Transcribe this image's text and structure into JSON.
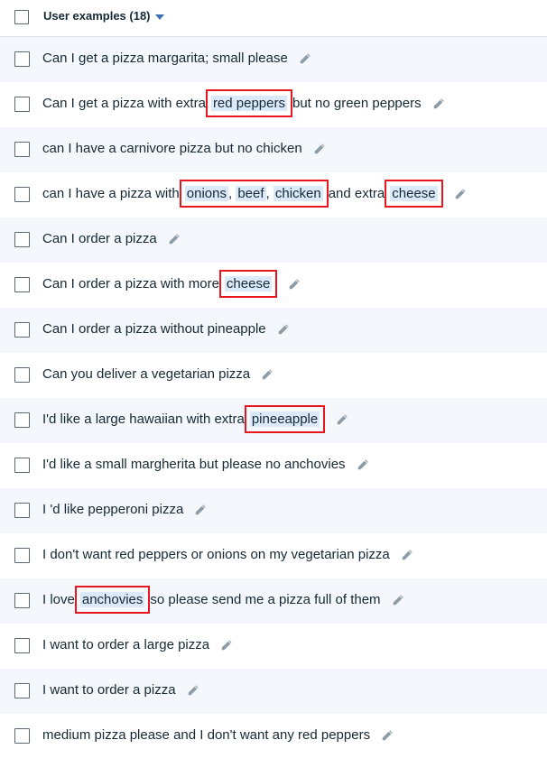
{
  "header": {
    "title": "User examples (18)"
  },
  "rows": [
    {
      "segments": [
        {
          "t": "Can I get a pizza margarita; small please"
        }
      ]
    },
    {
      "segments": [
        {
          "t": "Can I get a pizza with extra"
        },
        {
          "t": "red peppers",
          "ent": true,
          "box": true
        },
        {
          "t": "but no green peppers"
        }
      ]
    },
    {
      "segments": [
        {
          "t": "can I have a carnivore pizza but no chicken"
        }
      ]
    },
    {
      "segments": [
        {
          "t": "can I have a pizza with"
        },
        {
          "t": "onions",
          "ent": true,
          "box": "start"
        },
        {
          "t": ", ",
          "inbox": true
        },
        {
          "t": "beef",
          "ent": true,
          "inbox": true
        },
        {
          "t": ", ",
          "inbox": true
        },
        {
          "t": "chicken",
          "ent": true,
          "box": "end"
        },
        {
          "t": "and extra"
        },
        {
          "t": "cheese",
          "ent": true,
          "box": true
        }
      ]
    },
    {
      "segments": [
        {
          "t": "Can I order a pizza"
        }
      ]
    },
    {
      "segments": [
        {
          "t": "Can I order a pizza with more"
        },
        {
          "t": "cheese",
          "ent": true,
          "box": true
        }
      ]
    },
    {
      "segments": [
        {
          "t": "Can I order a pizza without pineapple"
        }
      ]
    },
    {
      "segments": [
        {
          "t": "Can you deliver a vegetarian pizza"
        }
      ]
    },
    {
      "segments": [
        {
          "t": "I'd like a large hawaiian with extra"
        },
        {
          "t": "pineeapple",
          "ent": true,
          "box": true
        }
      ]
    },
    {
      "segments": [
        {
          "t": "I'd like a small margherita but please no anchovies"
        }
      ]
    },
    {
      "segments": [
        {
          "t": "I 'd like pepperoni pizza"
        }
      ]
    },
    {
      "segments": [
        {
          "t": "I don't want red peppers or onions on my vegetarian pizza"
        }
      ]
    },
    {
      "segments": [
        {
          "t": "I love"
        },
        {
          "t": "anchovies",
          "ent": true,
          "box": true
        },
        {
          "t": "so please send me a pizza full of them"
        }
      ]
    },
    {
      "segments": [
        {
          "t": "I want to order a large pizza"
        }
      ]
    },
    {
      "segments": [
        {
          "t": "I want to order a pizza"
        }
      ]
    },
    {
      "segments": [
        {
          "t": "medium pizza please and I don't want any red peppers"
        }
      ]
    }
  ],
  "colors": {
    "entity_highlight": "#dbe9f9",
    "annotation_box": "#e8161f",
    "caret": "#3d70b2"
  }
}
